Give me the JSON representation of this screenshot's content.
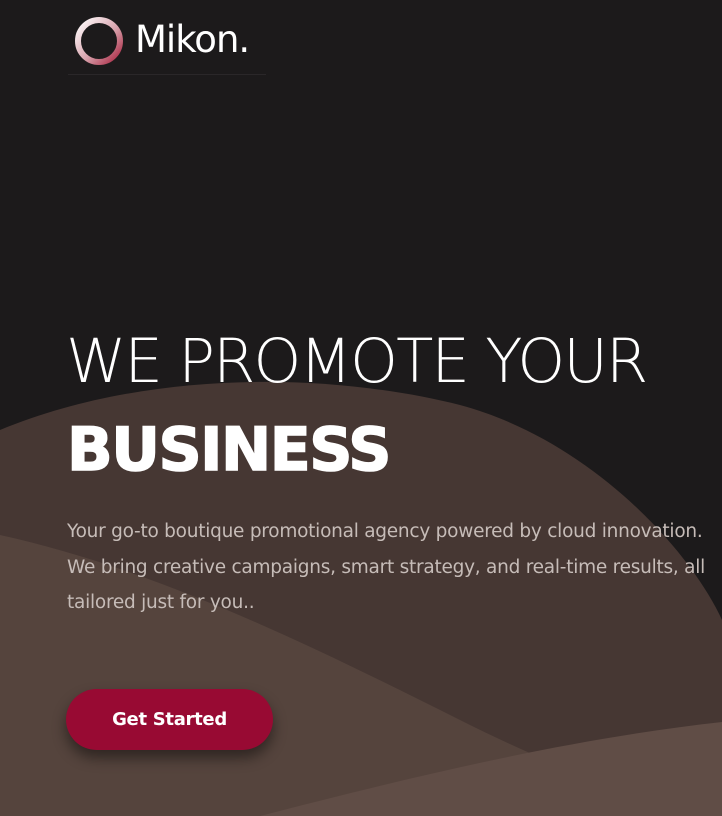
{
  "brand": {
    "name": "Mikon.",
    "logo_icon": "ring-logo-icon"
  },
  "hero": {
    "headline_line1": "WE PROMOTE YOUR",
    "headline_line2": "BUSINESS",
    "description": "Your go-to boutique promotional agency powered by cloud innovation. We bring creative campaigns, smart strategy, and real-time results, all tailored just for you..",
    "cta_label": "Get Started"
  },
  "colors": {
    "background": "#1c1a1b",
    "wave_light": "#5f4c45",
    "wave_dark": "#453733",
    "accent": "#980a33",
    "logo_ring_gradient": [
      "#ffffff",
      "#d8a3ad",
      "#a8233f"
    ],
    "text": "#ffffff",
    "text_muted": "#c6bcb8"
  }
}
